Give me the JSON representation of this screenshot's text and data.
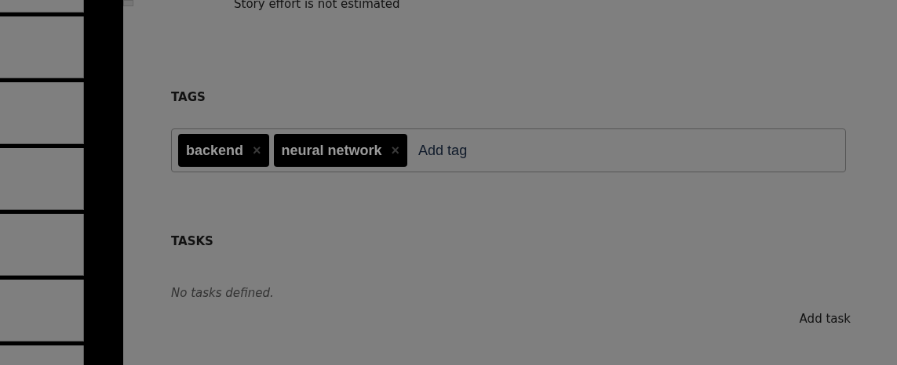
{
  "story_effort": "Story effort is not estimated",
  "tags_section": {
    "heading": "TAGS",
    "tags": [
      {
        "label": "backend",
        "remove": "×"
      },
      {
        "label": "neural network",
        "remove": "×"
      }
    ],
    "input": {
      "placeholder": "Add tag"
    }
  },
  "tasks_section": {
    "heading": "TASKS",
    "empty_message": "No tasks defined.",
    "add_button": "Add task"
  }
}
